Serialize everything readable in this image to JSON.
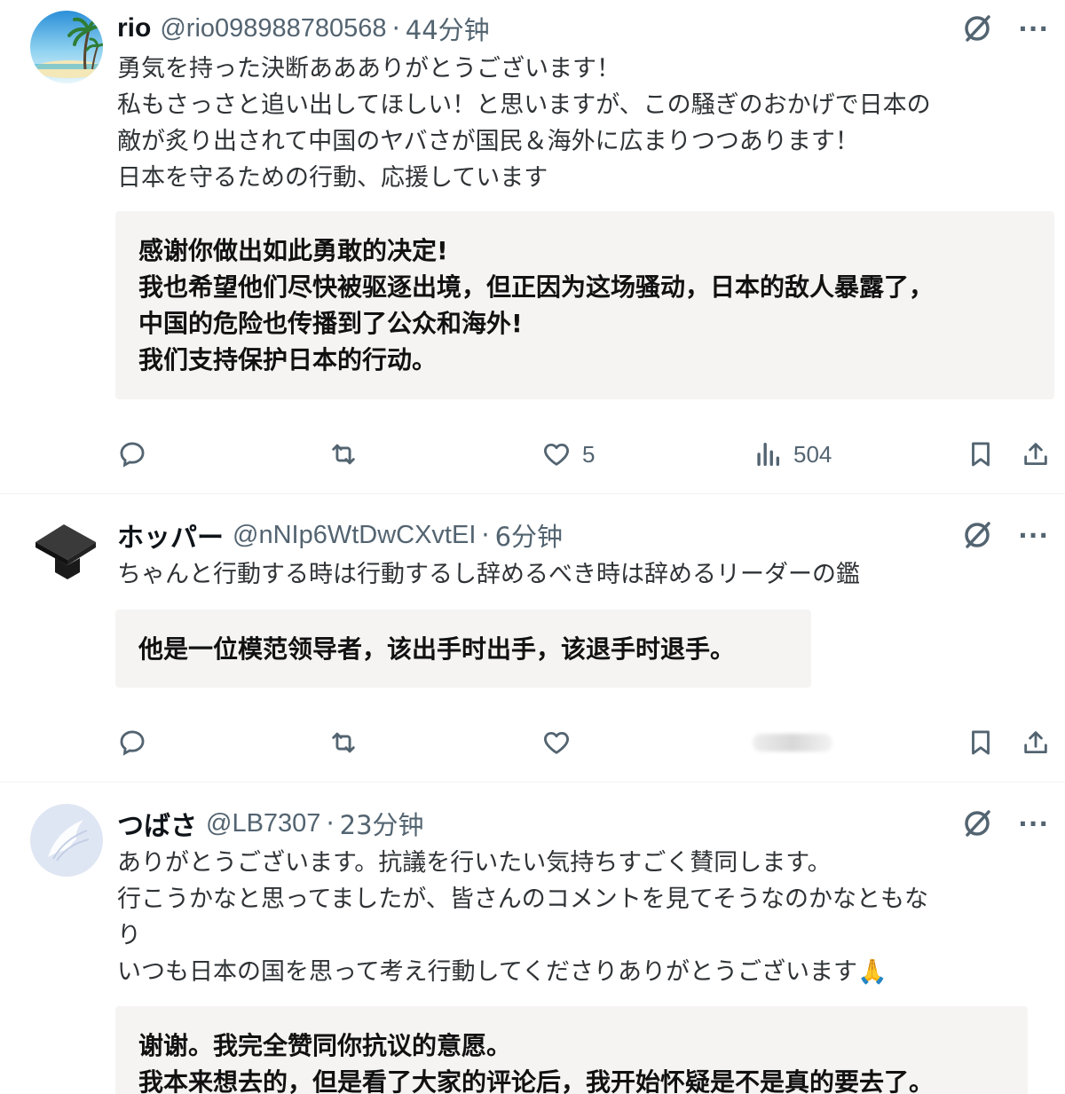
{
  "posts": [
    {
      "name": "rio",
      "handle": "@rio098988780568",
      "sep": "·",
      "time": "44分钟",
      "text": "勇気を持った決断ああありがとうございます！\n私もさっさと追い出してほしい！と思いますが、この騒ぎのおかげで日本の\n敵が炙り出されて中国のヤバさが国民＆海外に広まりつつあります！\n日本を守るための行動、応援しています",
      "translation": "感谢你做出如此勇敢的决定!\n我也希望他们尽快被驱逐出境，但正因为这场骚动，日本的敌人暴露了，\n中国的危险也传播到了公众和海外!\n我们支持保护日本的行动。",
      "likes": "5",
      "views": "504",
      "more": "···"
    },
    {
      "name": "ホッパー",
      "handle": "@nNIp6WtDwCXvtEI",
      "sep": "·",
      "time": "6分钟",
      "text": "ちゃんと行動する時は行動するし辞めるべき時は辞めるリーダーの鑑",
      "translation": "他是一位模范领导者，该出手时出手，该退手时退手。",
      "more": "···"
    },
    {
      "name": "つばさ",
      "handle": "@LB7307",
      "sep": "·",
      "time": "23分钟",
      "text": "ありがとうございます。抗議を行いたい気持ちすごく賛同します。\n行こうかなと思ってましたが、皆さんのコメントを見てそうなのかなともな\nり\nいつも日本の国を思って考え行動してくださりありがとうございます🙏",
      "translation": "谢谢。我完全赞同你抗议的意愿。\n我本来想去的，但是看了大家的评论后，我开始怀疑是不是真的要去了。",
      "more": "···"
    }
  ],
  "icons": {
    "reply": "reply-icon",
    "retweet": "retweet-icon",
    "like": "heart-icon",
    "views": "views-icon",
    "bookmark": "bookmark-icon",
    "share": "share-icon",
    "grok": "grok-icon",
    "more": "more-icon"
  },
  "colors": {
    "muted": "#536471",
    "text": "#0f1419",
    "translation_bg": "#f6f4f3"
  }
}
